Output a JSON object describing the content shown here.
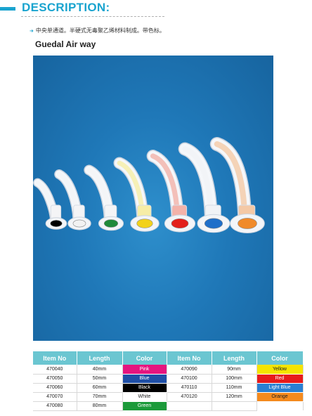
{
  "header": {
    "title": "DESCRIPTION:"
  },
  "description": "中央单通道。半硬式无毒聚乙烯材料制成。带色标。",
  "product_title": "Guedal Air way",
  "airways": [
    {
      "color": "#000000",
      "tint": "#f4f4f6"
    },
    {
      "color": "#f2f2f2",
      "tint": "#f4f4f6"
    },
    {
      "color": "#1f8a3a",
      "tint": "#f4f4f6"
    },
    {
      "color": "#f2d21b",
      "tint": "#f6eda6"
    },
    {
      "color": "#e3201b",
      "tint": "#f3b2a9"
    },
    {
      "color": "#1f6fc9",
      "tint": "#f1f3f6"
    },
    {
      "color": "#f08a2a",
      "tint": "#f4c9a6"
    }
  ],
  "table": {
    "headers": [
      "Item No",
      "Length",
      "Color",
      "Item No",
      "Length",
      "Color"
    ],
    "rows": [
      [
        {
          "item": "470040",
          "length": "40mm",
          "color": "Pink",
          "bg": "#e5157f",
          "fg": "#ffffff"
        },
        {
          "item": "470090",
          "length": "90mm",
          "color": "Yellow",
          "bg": "#f4e400",
          "fg": "#222222"
        }
      ],
      [
        {
          "item": "470050",
          "length": "50mm",
          "color": "Blue",
          "bg": "#1f4fa6",
          "fg": "#ffffff"
        },
        {
          "item": "470100",
          "length": "100mm",
          "color": "Red",
          "bg": "#e81b1b",
          "fg": "#ffffff"
        }
      ],
      [
        {
          "item": "470060",
          "length": "60mm",
          "color": "Black",
          "bg": "#000000",
          "fg": "#ffffff"
        },
        {
          "item": "470110",
          "length": "110mm",
          "color": "Light Blue",
          "bg": "#2a7fd2",
          "fg": "#ffffff"
        }
      ],
      [
        {
          "item": "470070",
          "length": "70mm",
          "color": "White",
          "bg": "#ffffff",
          "fg": "#222222"
        },
        {
          "item": "470120",
          "length": "120mm",
          "color": "Orange",
          "bg": "#f48a1e",
          "fg": "#222222"
        }
      ],
      [
        {
          "item": "470080",
          "length": "80mm",
          "color": "Green",
          "bg": "#1c9a3a",
          "fg": "#ffffff"
        },
        {
          "item": "",
          "length": "",
          "color": "",
          "bg": "#ffffff",
          "fg": "#222222"
        }
      ]
    ]
  }
}
